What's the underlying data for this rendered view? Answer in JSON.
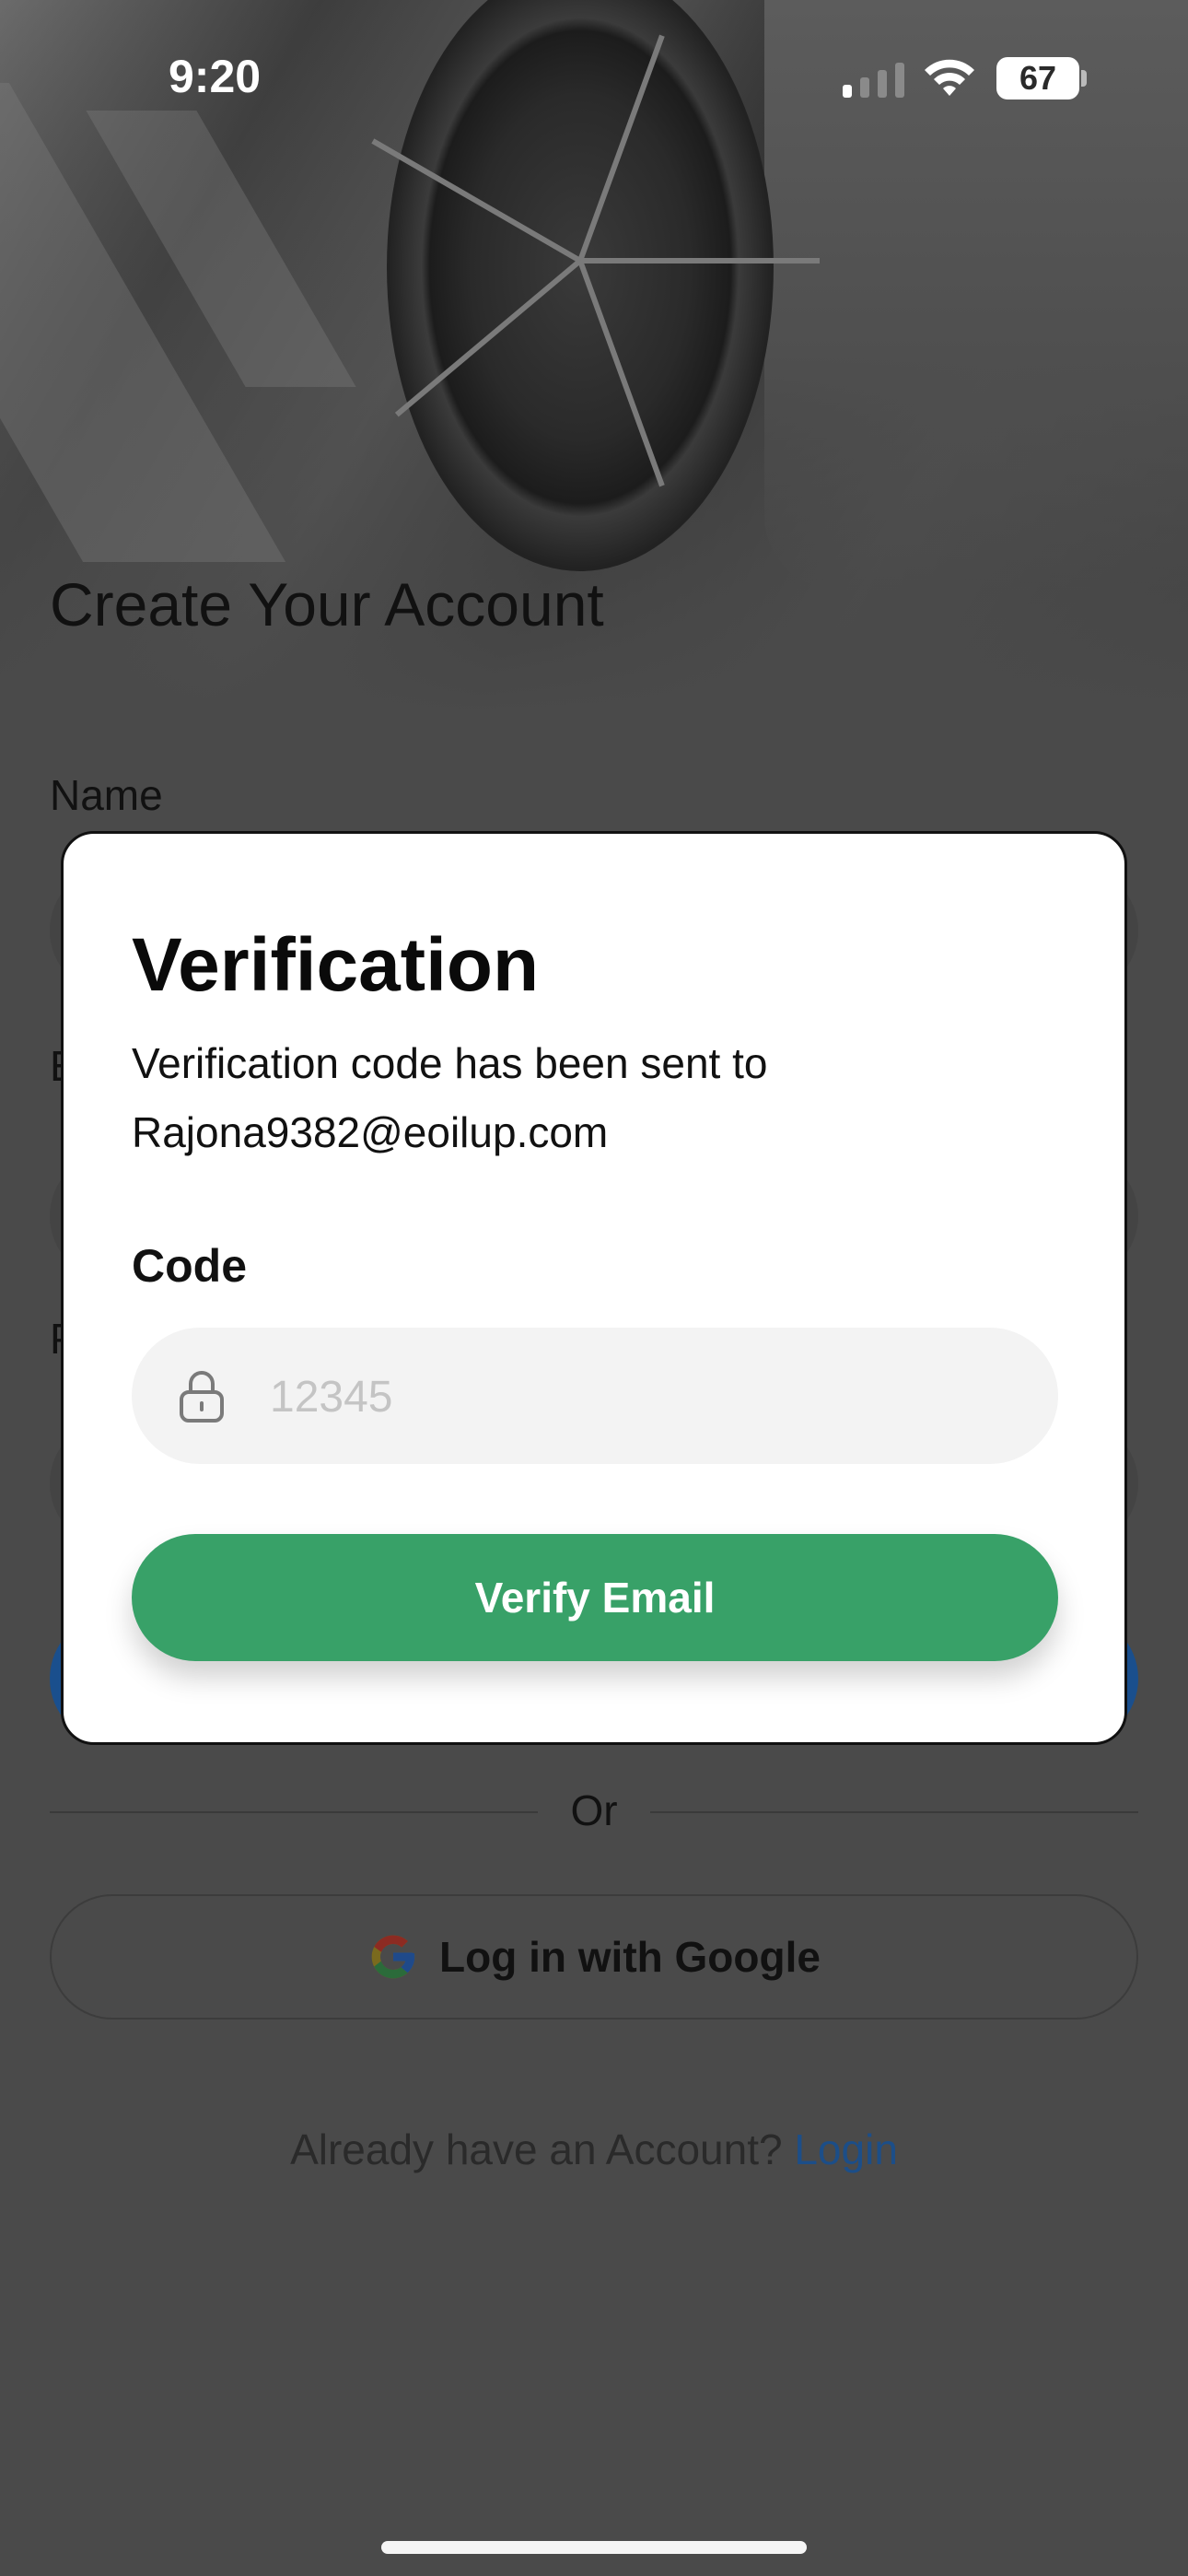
{
  "status_bar": {
    "time": "9:20",
    "battery": "67"
  },
  "background_form": {
    "title": "Create Your Account",
    "name_label": "Name",
    "email_label_partial": "E",
    "password_label_partial": "P",
    "divider_text": "Or",
    "google_button_label": "Log in with Google",
    "login_prompt": "Already have an Account? ",
    "login_link": "Login"
  },
  "modal": {
    "title": "Verification",
    "description": "Verification code has been sent to Rajona9382@eoilup.com",
    "code_label": "Code",
    "code_placeholder": "12345",
    "code_value": "",
    "verify_button": "Verify Email"
  },
  "colors": {
    "accent_green": "#38a168",
    "link_blue": "#1c4e88",
    "overlay": "#4a4a4a"
  },
  "icons": {
    "lock": "lock-icon",
    "google": "google-icon",
    "wifi": "wifi-icon",
    "signal": "signal-icon",
    "battery": "battery-icon"
  }
}
